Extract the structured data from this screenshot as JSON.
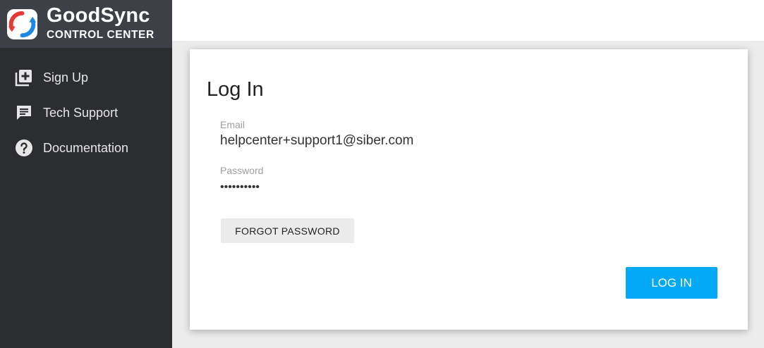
{
  "brand": {
    "name": "GoodSync",
    "subtitle": "CONTROL CENTER"
  },
  "sidebar": {
    "items": [
      {
        "label": "Sign Up",
        "icon": "add-box-icon"
      },
      {
        "label": "Tech Support",
        "icon": "chat-icon"
      },
      {
        "label": "Documentation",
        "icon": "help-circle-icon"
      }
    ]
  },
  "login": {
    "title": "Log In",
    "email_label": "Email",
    "email_value": "helpcenter+support1@siber.com",
    "password_label": "Password",
    "password_masked": "••••••••••",
    "forgot_label": "FORGOT PASSWORD",
    "submit_label": "LOG IN"
  },
  "colors": {
    "sidebar_bg": "#2b2d30",
    "brand_bg": "#3d4046",
    "accent": "#03a9f4",
    "page_bg": "#ececec"
  }
}
